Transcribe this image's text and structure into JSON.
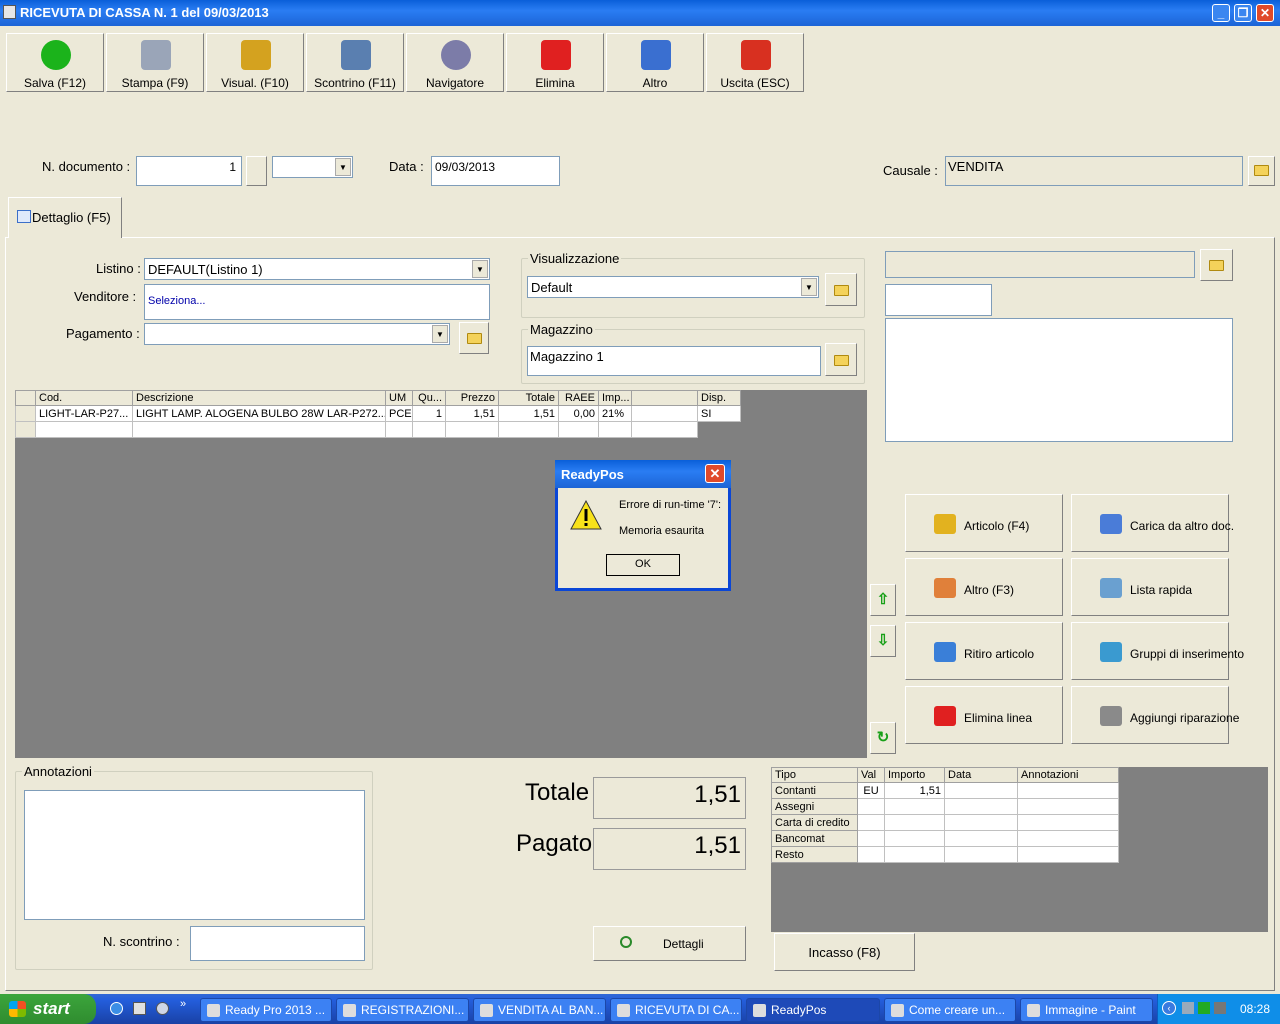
{
  "window": {
    "title": "RICEVUTA DI CASSA N. 1 del 09/03/2013"
  },
  "toolbar": [
    {
      "label": "Salva (F12)",
      "icon": "checkmark-icon"
    },
    {
      "label": "Stampa (F9)",
      "icon": "printer-icon"
    },
    {
      "label": "Visual. (F10)",
      "icon": "magic-wand-icon"
    },
    {
      "label": "Scontrino (F11)",
      "icon": "cash-register-icon"
    },
    {
      "label": "Navigatore",
      "icon": "compass-icon"
    },
    {
      "label": "Elimina",
      "icon": "delete-icon"
    },
    {
      "label": "Altro",
      "icon": "search-icon"
    },
    {
      "label": "Uscita (ESC)",
      "icon": "power-icon"
    }
  ],
  "header": {
    "doc_label": "N. documento :",
    "doc_value": "1",
    "data_label": "Data :",
    "data_value": "09/03/2013",
    "causale_label": "Causale :",
    "causale_value": "VENDITA"
  },
  "tab": {
    "label": "Dettaglio (F5)"
  },
  "form": {
    "listino_label": "Listino :",
    "listino_value": "DEFAULT(Listino 1)",
    "venditore_label": "Venditore :",
    "venditore_value": "Seleziona...",
    "pagamento_label": "Pagamento :",
    "pagamento_value": "",
    "visual_label": "Visualizzazione",
    "visual_value": "Default",
    "magazzino_label": "Magazzino",
    "magazzino_value": "Magazzino 1"
  },
  "grid": {
    "headers": [
      "Cod.",
      "Descrizione",
      "UM",
      "Qu...",
      "Prezzo",
      "Totale",
      "RAEE",
      "Imp...",
      "",
      "Disp."
    ],
    "rows": [
      [
        "LIGHT-LAR-P27...",
        "LIGHT LAMP. ALOGENA BULBO 28W LAR-P272...",
        "PCE",
        "1",
        "1,51",
        "1,51",
        "0,00",
        "21%",
        "",
        "SI"
      ]
    ]
  },
  "actions": [
    {
      "label": "Articolo (F4)",
      "icon": "box-add-icon"
    },
    {
      "label": "Carica da altro doc.",
      "icon": "checklist-icon"
    },
    {
      "label": "Altro (F3)",
      "icon": "grid-add-icon"
    },
    {
      "label": "Lista rapida",
      "icon": "quick-list-icon"
    },
    {
      "label": "Ritiro articolo",
      "icon": "return-arrow-icon"
    },
    {
      "label": "Gruppi di inserimento",
      "icon": "groups-icon"
    },
    {
      "label": "Elimina linea",
      "icon": "delete-line-icon"
    },
    {
      "label": "Aggiungi riparazione",
      "icon": "wrench-icon"
    }
  ],
  "annotazioni": {
    "label": "Annotazioni",
    "scontrino_label": "N. scontrino :",
    "scontrino_value": ""
  },
  "totals": {
    "totale_label": "Totale",
    "totale_value": "1,51",
    "pagato_label": "Pagato",
    "pagato_value": "1,51",
    "dettagli_label": "Dettagli"
  },
  "payments": {
    "headers": [
      "Tipo",
      "Val",
      "Importo",
      "Data",
      "Annotazioni"
    ],
    "rows": [
      [
        "Contanti",
        "EU",
        "1,51",
        "",
        ""
      ],
      [
        "Assegni",
        "",
        "",
        "",
        ""
      ],
      [
        "Carta di credito",
        "",
        "",
        "",
        ""
      ],
      [
        "Bancomat",
        "",
        "",
        "",
        ""
      ],
      [
        "Resto",
        "",
        "",
        "",
        ""
      ]
    ]
  },
  "incasso_label": "Incasso (F8)",
  "dialog": {
    "title": "ReadyPos",
    "line1": "Errore di run-time '7':",
    "line2": "Memoria esaurita",
    "ok": "OK"
  },
  "taskbar": {
    "start": "start",
    "tasks": [
      "Ready Pro 2013 ...",
      "REGISTRAZIONI...",
      "VENDITA AL BAN...",
      "RICEVUTA DI CA...",
      "ReadyPos",
      "Come creare un...",
      "Immagine - Paint"
    ],
    "clock": "08:28"
  }
}
